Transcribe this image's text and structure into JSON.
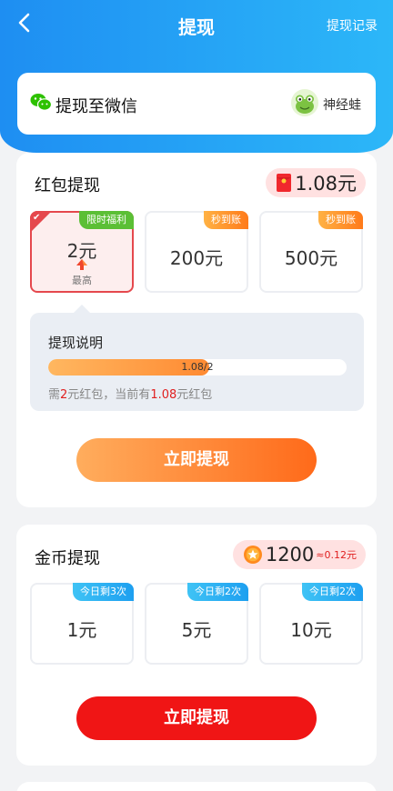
{
  "nav": {
    "title": "提现",
    "record_label": "提现记录"
  },
  "wechat": {
    "label": "提现至微信",
    "nickname": "神经蛙"
  },
  "red_packet": {
    "title": "红包提现",
    "balance": "1.08元",
    "options": [
      {
        "amount": "2元",
        "tag": "限时福利",
        "note": "最高",
        "selected": true
      },
      {
        "amount": "200元",
        "tag": "秒到账",
        "selected": false
      },
      {
        "amount": "500元",
        "tag": "秒到账",
        "selected": false
      }
    ],
    "explain": {
      "title": "提现说明",
      "progress_text": "1.08/2",
      "progress_fraction": 0.54,
      "note_prefix": "需",
      "note_need": "2",
      "note_mid": "元红包，当前有",
      "note_have": "1.08",
      "note_suffix": "元红包"
    },
    "cta": "立即提现"
  },
  "gold": {
    "title": "金币提现",
    "coins": "1200",
    "rate": "≈0.12元",
    "options": [
      {
        "amount": "1元",
        "tag": "今日剩3次"
      },
      {
        "amount": "5元",
        "tag": "今日剩2次"
      },
      {
        "amount": "10元",
        "tag": "今日剩2次"
      }
    ],
    "cta": "立即提现"
  },
  "colors": {
    "header_blue": "#1e8ef2",
    "accent_red": "#e5484d",
    "cta_red": "#f01515",
    "cta_orange": "#ff6a1a"
  }
}
